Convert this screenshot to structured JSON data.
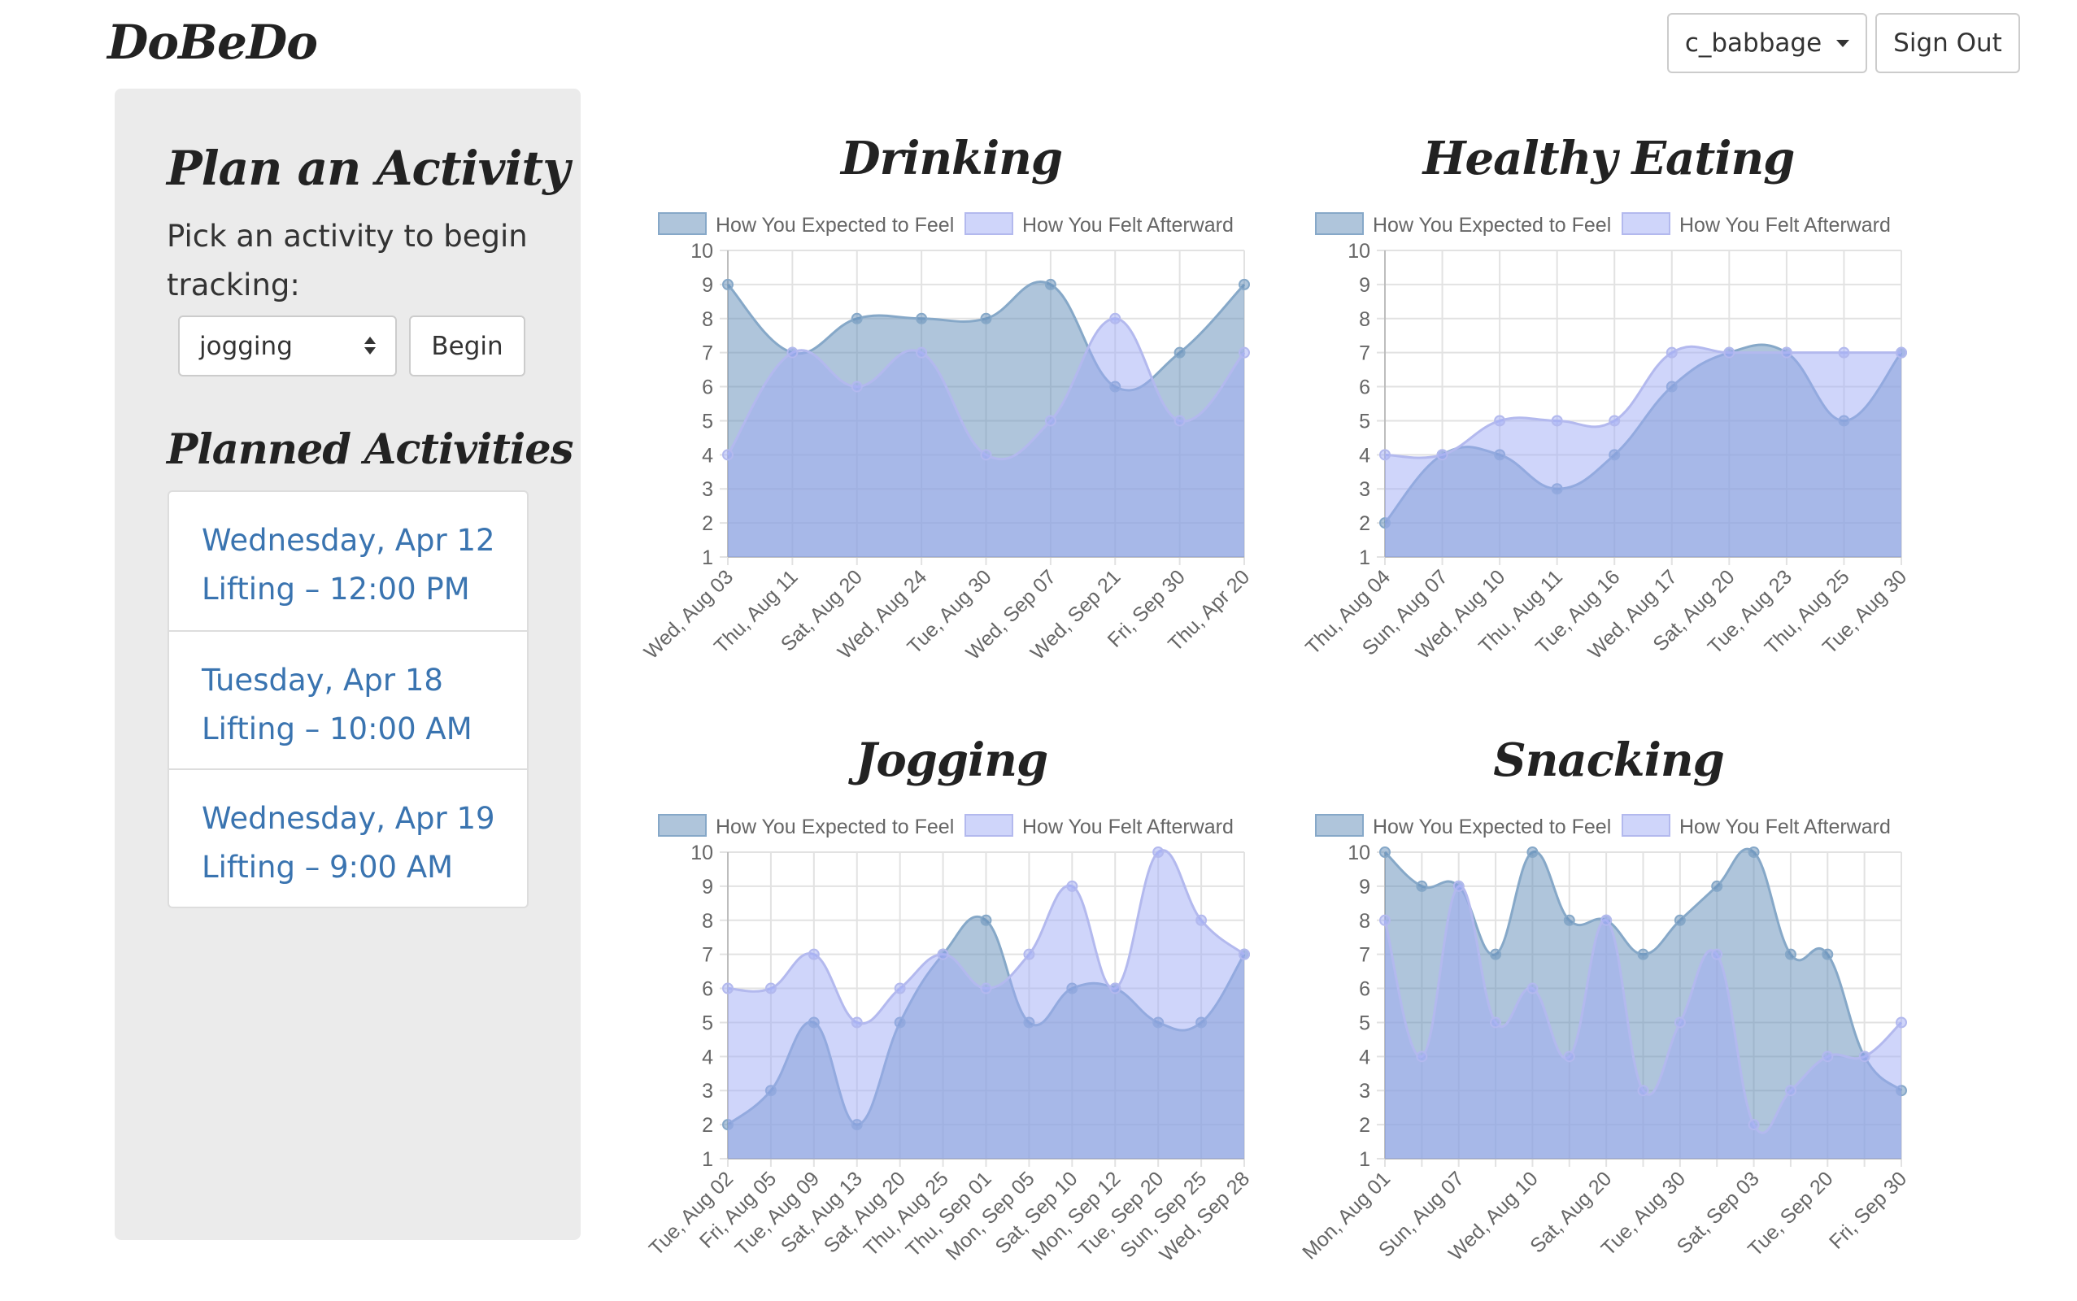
{
  "app": {
    "brand": "DoBeDo"
  },
  "header": {
    "user_label": "c_babbage",
    "signout_label": "Sign Out"
  },
  "sidebar": {
    "plan_title": "Plan an Activity",
    "plan_prompt": "Pick an activity to begin tracking:",
    "activity_select_value": "jogging",
    "begin_label": "Begin",
    "planned_title": "Planned Activities",
    "planned": [
      {
        "date": "Wednesday, Apr 12",
        "detail": "Lifting – 12:00 PM"
      },
      {
        "date": "Tuesday, Apr 18",
        "detail": "Lifting – 10:00 AM"
      },
      {
        "date": "Wednesday, Apr 19",
        "detail": "Lifting – 9:00 AM"
      }
    ]
  },
  "legend": {
    "expected": "How You Expected to Feel",
    "afterward": "How You Felt Afterward"
  },
  "colors": {
    "expected_fill": "rgba(96,140,184,0.5)",
    "expected_line": "#86a8c8",
    "afterward_fill": "rgba(160,172,245,0.5)",
    "afterward_line": "#b3b9ee",
    "link": "#3a74b0"
  },
  "chart_data": [
    {
      "type": "area",
      "title": "Drinking",
      "categories": [
        "Wed, Aug 03",
        "Thu, Aug 11",
        "Sat, Aug 20",
        "Wed, Aug 24",
        "Tue, Aug 30",
        "Wed, Sep 07",
        "Wed, Sep 21",
        "Fri, Sep 30",
        "Thu, Apr 20"
      ],
      "series": [
        {
          "name": "How You Expected to Feel",
          "values": [
            9,
            7,
            8,
            8,
            8,
            9,
            6,
            7,
            9
          ]
        },
        {
          "name": "How You Felt Afterward",
          "values": [
            4,
            7,
            6,
            7,
            4,
            5,
            8,
            5,
            7
          ]
        }
      ],
      "ylim": [
        1,
        10
      ],
      "grid": true,
      "legend": "top"
    },
    {
      "type": "area",
      "title": "Healthy Eating",
      "categories": [
        "Thu, Aug 04",
        "Sun, Aug 07",
        "Wed, Aug 10",
        "Thu, Aug 11",
        "Tue, Aug 16",
        "Wed, Aug 17",
        "Sat, Aug 20",
        "Tue, Aug 23",
        "Thu, Aug 25",
        "Tue, Aug 30"
      ],
      "series": [
        {
          "name": "How You Expected to Feel",
          "values": [
            2,
            4,
            4,
            3,
            4,
            6,
            7,
            7,
            5,
            7
          ]
        },
        {
          "name": "How You Felt Afterward",
          "values": [
            4,
            4,
            5,
            5,
            5,
            7,
            7,
            7,
            7,
            7
          ]
        }
      ],
      "ylim": [
        1,
        10
      ],
      "grid": true,
      "legend": "top"
    },
    {
      "type": "area",
      "title": "Jogging",
      "categories": [
        "Tue, Aug 02",
        "Fri, Aug 05",
        "Tue, Aug 09",
        "Sat, Aug 13",
        "Sat, Aug 20",
        "Thu, Aug 25",
        "Thu, Sep 01",
        "Mon, Sep 05",
        "Sat, Sep 10",
        "Mon, Sep 12",
        "Tue, Sep 20",
        "Sun, Sep 25",
        "Wed, Sep 28"
      ],
      "series": [
        {
          "name": "How You Expected to Feel",
          "values": [
            2,
            3,
            5,
            2,
            5,
            7,
            8,
            5,
            6,
            6,
            5,
            5,
            7
          ]
        },
        {
          "name": "How You Felt Afterward",
          "values": [
            6,
            6,
            7,
            5,
            6,
            7,
            6,
            7,
            9,
            6,
            10,
            8,
            7
          ]
        }
      ],
      "ylim": [
        1,
        10
      ],
      "grid": true,
      "legend": "top"
    },
    {
      "type": "area",
      "title": "Snacking",
      "categories": [
        "Mon, Aug 01",
        "",
        "Sun, Aug 07",
        "",
        "Wed, Aug 10",
        "",
        "Sat, Aug 20",
        "",
        "Tue, Aug 30",
        "",
        "Sat, Sep 03",
        "",
        "Tue, Sep 20",
        "",
        "Fri, Sep 30"
      ],
      "series": [
        {
          "name": "How You Expected to Feel",
          "values": [
            10,
            9,
            9,
            7,
            10,
            8,
            8,
            7,
            8,
            9,
            10,
            7,
            7,
            4,
            3
          ]
        },
        {
          "name": "How You Felt Afterward",
          "values": [
            8,
            4,
            9,
            5,
            6,
            4,
            8,
            3,
            5,
            7,
            2,
            3,
            4,
            4,
            5
          ]
        }
      ],
      "ylim": [
        1,
        10
      ],
      "grid": true,
      "legend": "top"
    }
  ]
}
